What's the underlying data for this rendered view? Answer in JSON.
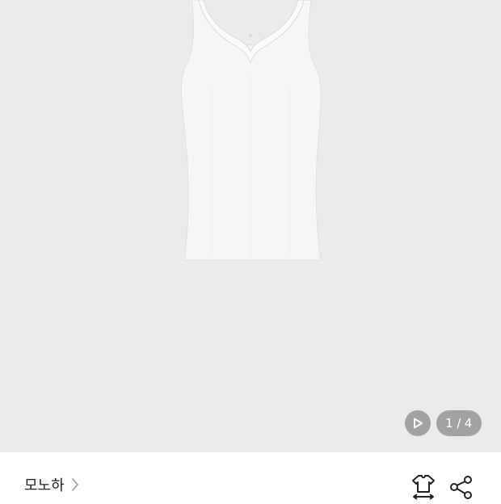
{
  "gallery": {
    "image_name": "sleeveless-lace-tank-top",
    "page_current": "1",
    "page_separator": "/",
    "page_total": "4",
    "background": "#ebebeb",
    "control_color": "#a2a2a2",
    "play_icon": "play-icon"
  },
  "brand": {
    "name": "모노하",
    "chevron_icon": "chevron-right-icon"
  },
  "actions": {
    "size_icon": "size-guide-icon",
    "share_icon": "share-icon"
  }
}
